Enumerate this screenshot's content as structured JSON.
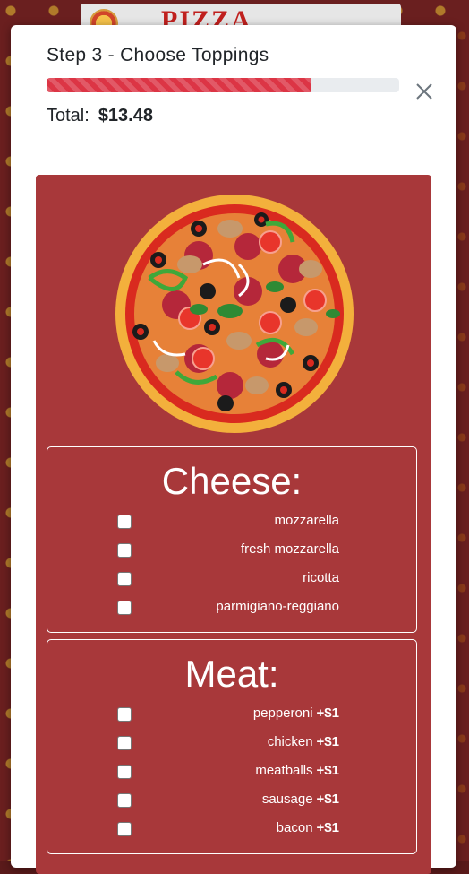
{
  "banner": {
    "logo_text": "PIZZA"
  },
  "modal": {
    "step_title": "Step 3 - Choose Toppings",
    "progress": 0.75,
    "total_label": "Total:",
    "total_amount": "$13.48",
    "close_icon": "close-icon"
  },
  "colors": {
    "panel": "#a8383a",
    "progress": "#dc3545",
    "backdrop": "#6a1f1f"
  },
  "cheese": {
    "title": "Cheese:",
    "options": [
      {
        "label": "mozzarella",
        "price": ""
      },
      {
        "label": "fresh mozzarella",
        "price": ""
      },
      {
        "label": "ricotta",
        "price": ""
      },
      {
        "label": "parmigiano-reggiano",
        "price": ""
      }
    ]
  },
  "meat": {
    "title": "Meat:",
    "options": [
      {
        "label": "pepperoni",
        "price": "+$1"
      },
      {
        "label": "chicken",
        "price": "+$1"
      },
      {
        "label": "meatballs",
        "price": "+$1"
      },
      {
        "label": "sausage",
        "price": "+$1"
      },
      {
        "label": "bacon",
        "price": "+$1"
      }
    ]
  }
}
